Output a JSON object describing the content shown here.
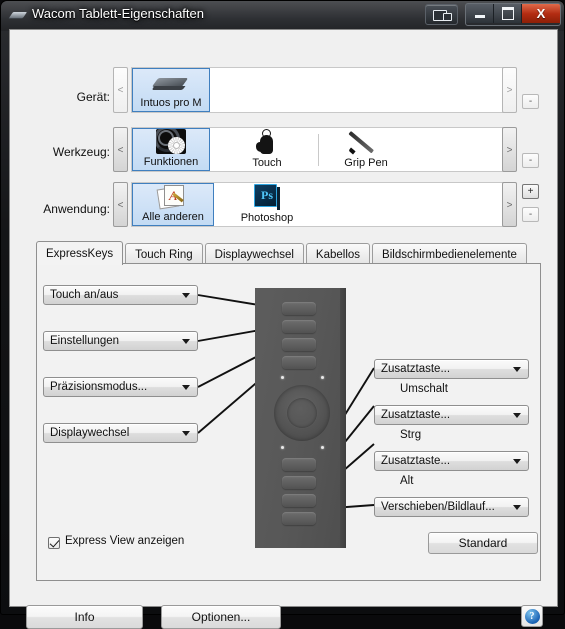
{
  "window": {
    "title": "Wacom Tablett-Eigenschaften",
    "icon": "wacom-tablet-icon",
    "buttons": {
      "extra": "display-toggle-button",
      "minimize": "–",
      "maximize": "❐",
      "close": "X"
    },
    "accent_close": "#b22c12",
    "selected_tile_bg": "#c3dbf4",
    "selected_tile_border": "#3f7fbf"
  },
  "selectors": [
    {
      "label": "Gerät:",
      "prev_label": "<",
      "next_label": ">",
      "minus_label": "-",
      "plus_label": "",
      "items": [
        {
          "label": "Intuos pro M",
          "icon": "tablet-icon",
          "selected": true
        }
      ]
    },
    {
      "label": "Werkzeug:",
      "prev_label": "<",
      "next_label": ">",
      "minus_label": "-",
      "plus_label": "",
      "items": [
        {
          "label": "Funktionen",
          "icon": "functions-icon",
          "selected": true
        },
        {
          "label": "Touch",
          "icon": "touch-finger-icon",
          "selected": false
        },
        {
          "label": "Grip Pen",
          "icon": "pen-icon",
          "selected": false
        }
      ]
    },
    {
      "label": "Anwendung:",
      "prev_label": "<",
      "next_label": ">",
      "minus_label": "-",
      "plus_label": "+",
      "items": [
        {
          "label": "Alle anderen",
          "icon": "all-other-apps-icon",
          "selected": true
        },
        {
          "label": "Photoshop",
          "icon": "photoshop-icon",
          "selected": false
        }
      ]
    }
  ],
  "tabs": [
    {
      "label": "ExpressKeys",
      "active": true
    },
    {
      "label": "Touch Ring",
      "active": false
    },
    {
      "label": "Displaywechsel",
      "active": false
    },
    {
      "label": "Kabellos",
      "active": false
    },
    {
      "label": "Bildschirmbedienelemente",
      "active": false
    }
  ],
  "expresskeys": {
    "left": [
      {
        "value": "Touch an/aus",
        "sublabel": ""
      },
      {
        "value": "Einstellungen",
        "sublabel": ""
      },
      {
        "value": "Präzisionsmodus...",
        "sublabel": ""
      },
      {
        "value": "Displaywechsel",
        "sublabel": ""
      }
    ],
    "right": [
      {
        "value": "Zusatztaste...",
        "sublabel": "Umschalt"
      },
      {
        "value": "Zusatztaste...",
        "sublabel": "Strg"
      },
      {
        "value": "Zusatztaste...",
        "sublabel": "Alt"
      },
      {
        "value": "Verschieben/Bildlauf...",
        "sublabel": ""
      }
    ],
    "tablet_graphic": "intuos-pro-m-diagram"
  },
  "panel_footer": {
    "checkbox_label": "Express View anzeigen",
    "checkbox_checked": true,
    "default_button": "Standard"
  },
  "footer": {
    "info_button": "Info",
    "options_button": "Optionen...",
    "help_button": "?"
  }
}
